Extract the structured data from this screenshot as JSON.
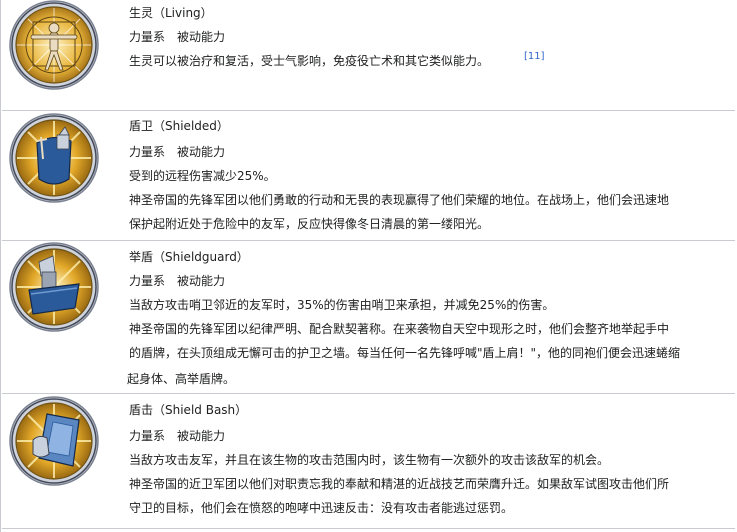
{
  "abilities": [
    {
      "name": "生灵（Living）",
      "type": "力量系　被动能力",
      "lines": [
        "生灵可以被治疗和复活，受士气影响，免疫役亡术和其它类似能力。"
      ],
      "citation": "[11]",
      "icon": "vitruvian-man-icon"
    },
    {
      "name": "盾卫（Shielded）",
      "type": "力量系　被动能力",
      "lines": [
        "受到的远程伤害减少25%。",
        "神圣帝国的先锋军团以他们勇敢的行动和无畏的表现赢得了他们荣耀的地位。在战场上，他们会迅速地",
        "保护起附近处于危险中的友军，反应快得像冬日清晨的第一缕阳光。"
      ],
      "icon": "shielded-knight-icon"
    },
    {
      "name": "举盾（Shieldguard）",
      "type": "力量系　被动能力",
      "lines": [
        "当敌方攻击哨卫邻近的友军时，35%的伤害由哨卫来承担，并减免25%的伤害。",
        "神圣帝国的先锋军团以纪律严明、配合默契著称。在来袭物自天空中现形之时，他们会整齐地举起手中",
        "的盾牌，在头顶组成无懈可击的护卫之墙。每当任何一名先锋呼喊\"盾上肩！\"，他的同袍们便会迅速蜷缩",
        "起身体、高举盾牌。"
      ],
      "icon": "shieldguard-icon"
    },
    {
      "name": "盾击（Shield Bash）",
      "type": "力量系　被动能力",
      "lines": [
        "当敌方攻击友军，并且在该生物的攻击范围内时，该生物有一次额外的攻击该敌军的机会。",
        "神圣帝国的近卫军团以他们对职责忘我的奉献和精湛的近战技艺而荣膺升迁。如果敌军试图攻击他们所",
        "守卫的目标，他们会在愤怒的咆哮中迅速反击：没有攻击者能逃过惩罚。"
      ],
      "icon": "shield-bash-icon"
    }
  ],
  "colors": {
    "text": "#202122",
    "separator": "#c8ccd1",
    "link": "#3366cc",
    "icon_gold": "#d9a520",
    "icon_blue": "#2a5a9a"
  }
}
